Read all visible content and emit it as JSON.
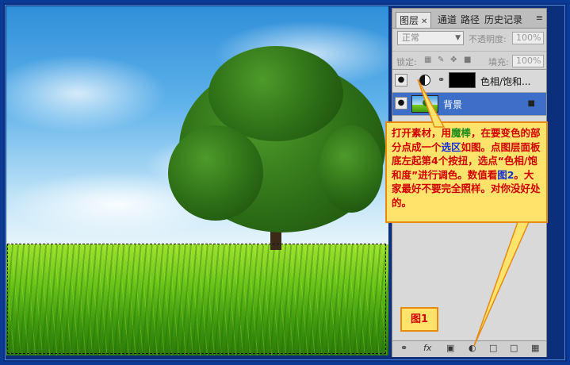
{
  "panel": {
    "tabs": [
      {
        "label": "图层",
        "active": true
      },
      {
        "label": "通道"
      },
      {
        "label": "路径"
      },
      {
        "label": "历史记录"
      }
    ],
    "blend_mode": "正常",
    "opacity_label": "不透明度:",
    "opacity_value": "100%",
    "lock_label": "锁定:",
    "fill_label": "填充:",
    "fill_value": "100%",
    "layers": [
      {
        "name": "色相/饱和...",
        "type": "adjustment"
      },
      {
        "name": "背景",
        "type": "background",
        "selected": true
      }
    ],
    "bottom_icons": [
      "link-icon",
      "fx-icon",
      "mask-icon",
      "adjustment-icon",
      "folder-icon",
      "new-layer-icon",
      "trash-icon"
    ]
  },
  "note": {
    "line_parts": [
      {
        "text": "打开素材，用"
      },
      {
        "text": "魔棒",
        "color": "green"
      },
      {
        "text": "，在要变色的部分点成一个"
      },
      {
        "text": "选区",
        "color": "blue"
      },
      {
        "text": "如图。点图层面板底左起第4个按扭，选点“色相/饱和度”进行调色。数值看"
      },
      {
        "text": "图2",
        "color": "blue"
      },
      {
        "text": "。大家最好不要完全照样。对你没好处的。"
      }
    ]
  },
  "figure_label": "图1",
  "colors": {
    "frame": "#0b2f7a",
    "note_bg": "#ffe36a",
    "note_border": "#e68a12",
    "note_text": "#d10000",
    "selected_layer": "#3d6fc8"
  }
}
